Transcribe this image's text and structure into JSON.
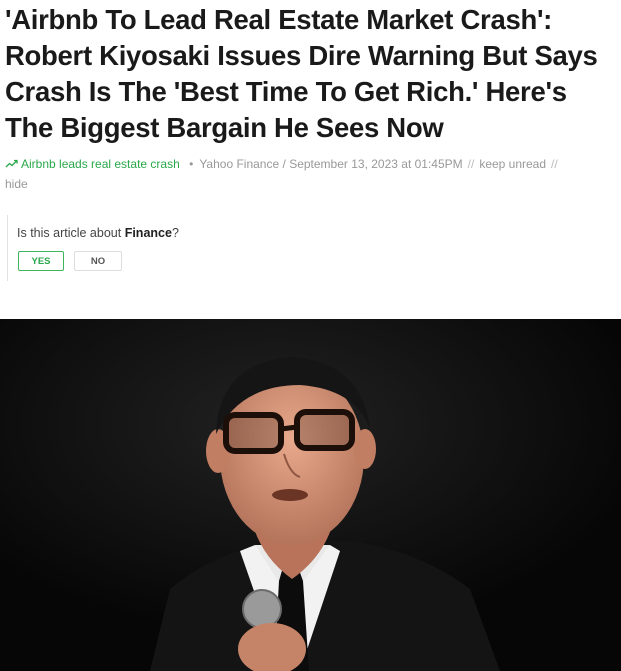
{
  "article": {
    "headline": "'Airbnb To Lead Real Estate Market Crash': Robert Kiyosaki Issues Dire Warning But Says Crash Is The 'Best Time To Get Rich.' Here's The Biggest Bargain He Sees Now",
    "trend_label": "Airbnb leads real estate crash",
    "source": "Yahoo Finance",
    "date": "September 13, 2023 at 01:45PM",
    "keep_unread": "keep unread",
    "hide": "hide",
    "separator": "//"
  },
  "survey": {
    "question_prefix": "Is this article about ",
    "topic": "Finance",
    "question_suffix": "?",
    "yes_label": "YES",
    "no_label": "NO"
  },
  "colors": {
    "trend_green": "#2aa84a",
    "yes_border": "#3cb55d",
    "meta_gray": "#999999",
    "photo_background": "#070707"
  },
  "icons": {
    "trend": "trending-up-icon"
  }
}
